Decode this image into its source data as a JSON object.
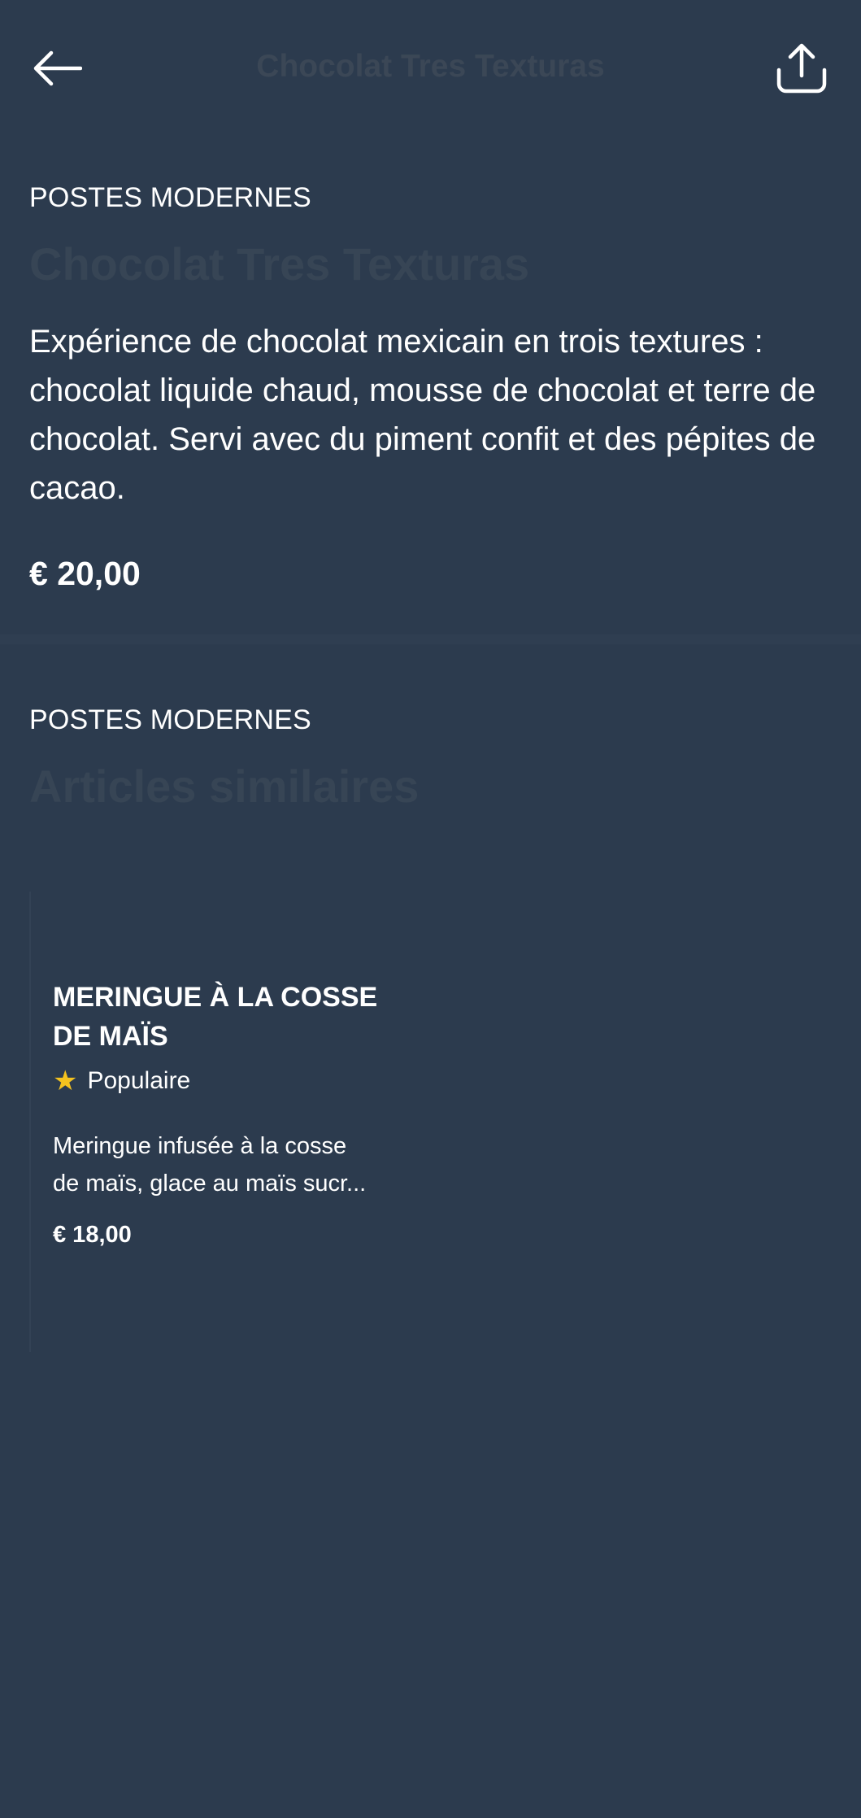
{
  "header": {
    "title": "Chocolat Tres Texturas",
    "back_icon": "arrow-left-icon",
    "share_icon": "share-icon"
  },
  "item": {
    "category": "POSTES MODERNES",
    "name": "Chocolat Tres Texturas",
    "description": "Expérience de chocolat mexicain en trois textures : chocolat liquide chaud, mousse de chocolat et terre de chocolat. Servi avec du piment confit et des pépites de cacao.",
    "price": "€ 20,00"
  },
  "similar": {
    "category": "POSTES MODERNES",
    "heading": "Articles similaires",
    "items": [
      {
        "title": "MERINGUE À LA COSSE DE MAÏS",
        "badge": "Populaire",
        "badge_icon": "star-icon",
        "description_line1": "Meringue infusée à la cosse",
        "description_line2": "de maïs, glace au maïs sucr...",
        "price": "€ 18,00"
      }
    ]
  },
  "colors": {
    "background": "#2c3b4e",
    "star": "#f4c21f",
    "muted_heading": "#374555"
  }
}
